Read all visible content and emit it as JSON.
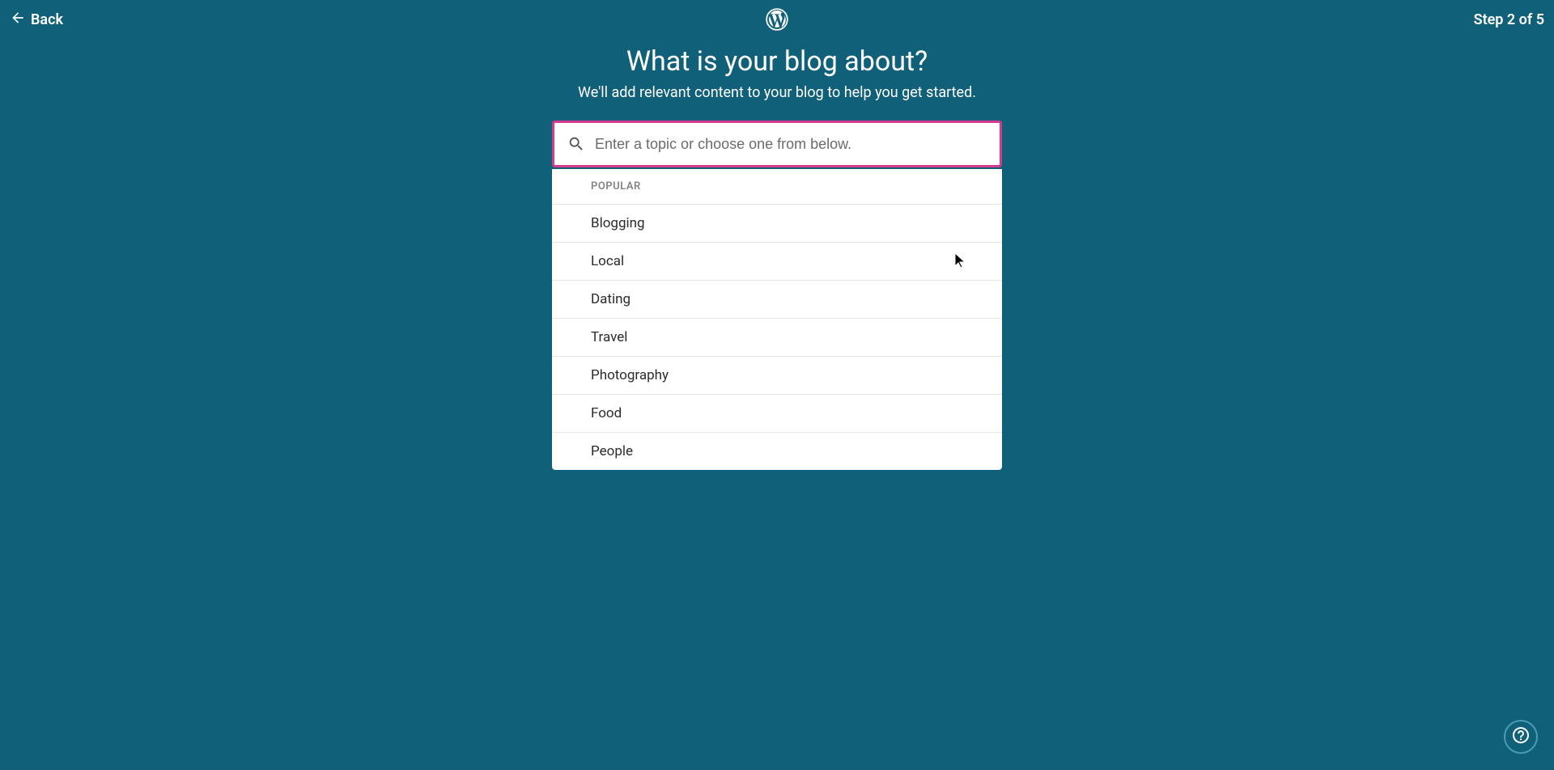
{
  "header": {
    "back_label": "Back",
    "step_label": "Step 2 of 5"
  },
  "content": {
    "title": "What is your blog about?",
    "subtitle": "We'll add relevant content to your blog to help you get started."
  },
  "search": {
    "placeholder": "Enter a topic or choose one from below."
  },
  "dropdown": {
    "header": "POPULAR",
    "items": [
      {
        "label": "Blogging"
      },
      {
        "label": "Local"
      },
      {
        "label": "Dating"
      },
      {
        "label": "Travel"
      },
      {
        "label": "Photography"
      },
      {
        "label": "Food"
      },
      {
        "label": "People"
      }
    ]
  }
}
